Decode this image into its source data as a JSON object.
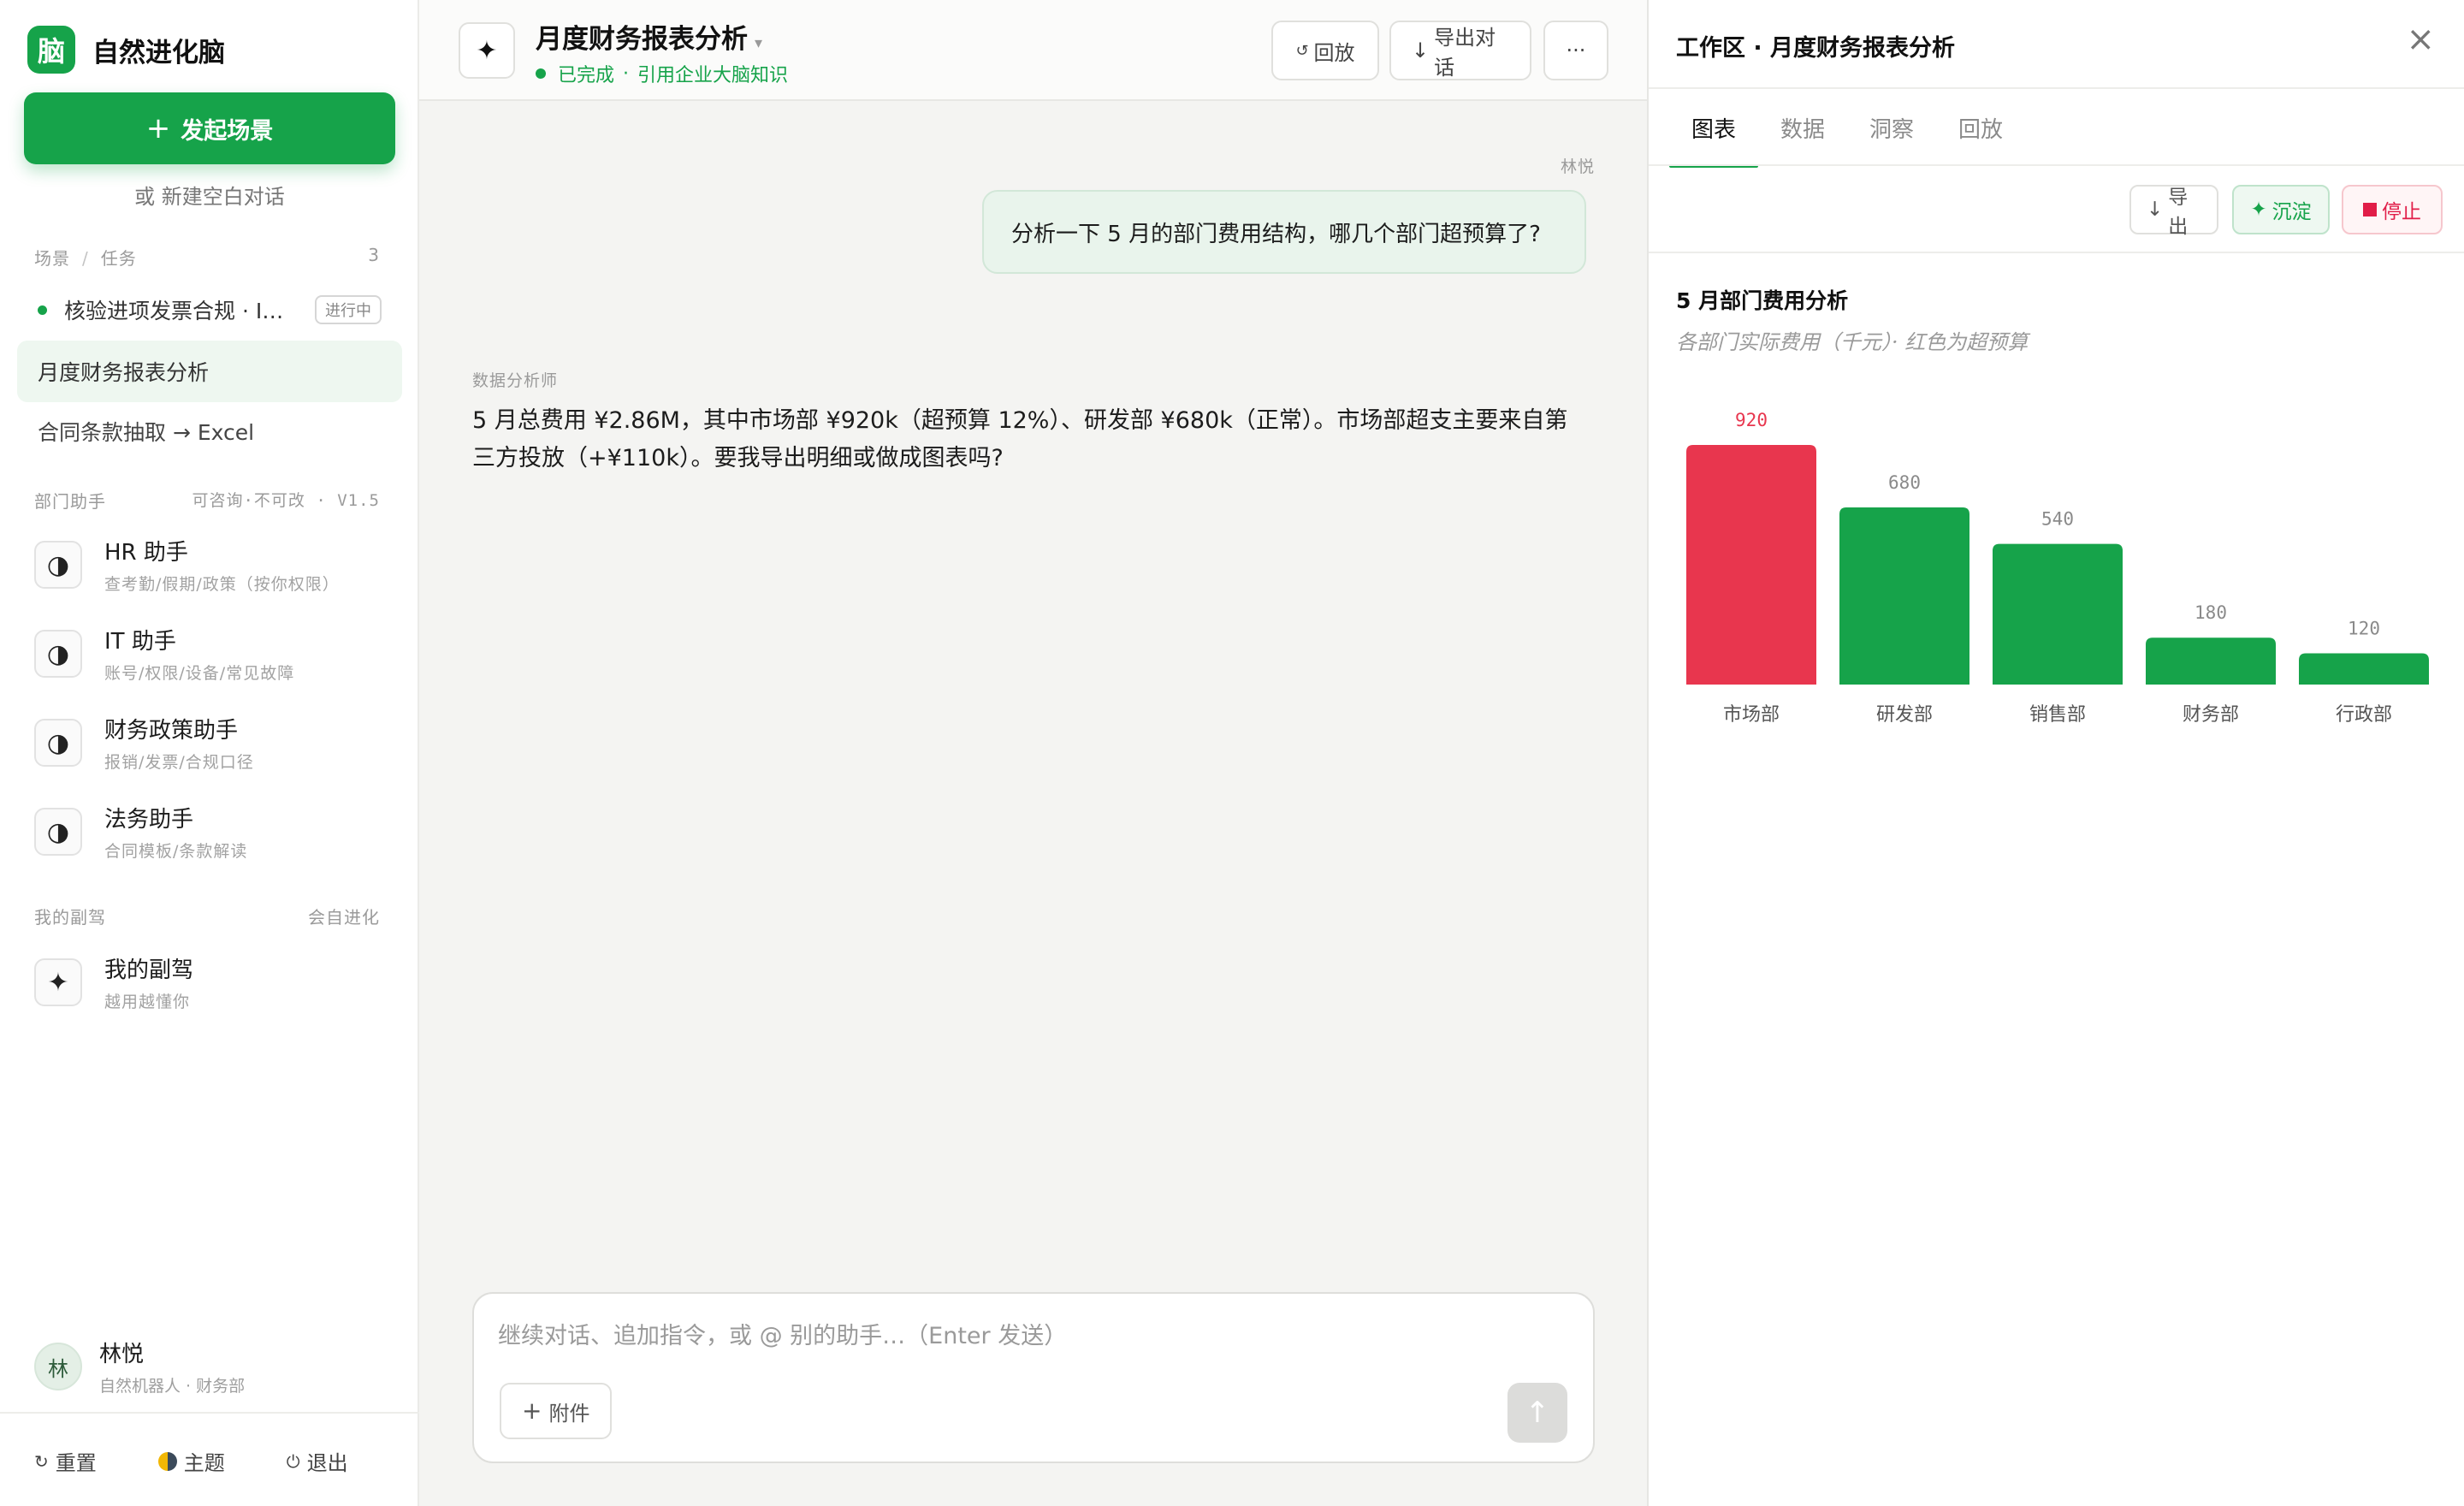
{
  "brand": {
    "logo_char": "脑",
    "name": "自然进化脑"
  },
  "sidebar": {
    "new_scene_plus": "+",
    "new_scene_label": "发起场景",
    "blank_chat": "或 新建空白对话",
    "tasks_header": {
      "left": "场景",
      "sep": "/",
      "right": "任务",
      "count": "3"
    },
    "tasks": [
      {
        "label": "核验进项发票合规 · I…",
        "badge": "进行中"
      },
      {
        "label": "月度财务报表分析"
      },
      {
        "label": "合同条款抽取 → Excel"
      }
    ],
    "assistants_header": {
      "left": "部门助手",
      "right": "可咨询·不可改 · V1.5"
    },
    "assistants": [
      {
        "name": "HR 助手",
        "desc": "查考勤/假期/政策（按你权限）"
      },
      {
        "name": "IT 助手",
        "desc": "账号/权限/设备/常见故障"
      },
      {
        "name": "财务政策助手",
        "desc": "报销/发票/合规口径"
      },
      {
        "name": "法务助手",
        "desc": "合同模板/条款解读"
      }
    ],
    "copilot_header": {
      "left": "我的副驾",
      "right": "会自进化"
    },
    "copilot": {
      "name": "我的副驾",
      "desc": "越用越懂你"
    },
    "user": {
      "avatar": "林",
      "name": "林悦",
      "sub": "自然机器人 · 财务部"
    },
    "footer": {
      "reset": "重置",
      "theme": "主题",
      "logout": "退出"
    }
  },
  "chat": {
    "title": "月度财务报表分析",
    "status": "已完成",
    "status_extra": "引用企业大脑知识",
    "buttons": {
      "replay": "回放",
      "export": "导出对话",
      "more": "···"
    },
    "messages": [
      {
        "sender": "林悦",
        "text": "分析一下 5 月的部门费用结构，哪几个部门超预算了?"
      },
      {
        "sender": "数据分析师",
        "text": "5 月总费用 ¥2.86M，其中市场部 ¥920k（超预算 12%）、研发部 ¥680k（正常）。市场部超支主要来自第三方投放（+¥110k）。要我导出明细或做成图表吗?"
      }
    ],
    "composer": {
      "placeholder": "继续对话、追加指令，或 @ 别的助手…（Enter 发送）",
      "attach": "附件"
    }
  },
  "workspace": {
    "title": "工作区 · 月度财务报表分析",
    "tabs": [
      "图表",
      "数据",
      "洞察",
      "回放"
    ],
    "active_tab": 0,
    "tools": {
      "export": "导出",
      "save": "沉淀",
      "stop": "停止"
    },
    "colors": {
      "accent": "#16a34a",
      "over_budget": "#e8364e"
    }
  },
  "chart_data": {
    "type": "bar",
    "title": "5 月部门费用分析",
    "subtitle": "各部门实际费用（千元）· 红色为超预算",
    "categories": [
      "市场部",
      "研发部",
      "销售部",
      "财务部",
      "行政部"
    ],
    "values": [
      920,
      680,
      540,
      180,
      120
    ],
    "over_budget": [
      true,
      false,
      false,
      false,
      false
    ],
    "ylim": [
      0,
      920
    ],
    "grid": false,
    "xlabel": "",
    "ylabel": ""
  }
}
